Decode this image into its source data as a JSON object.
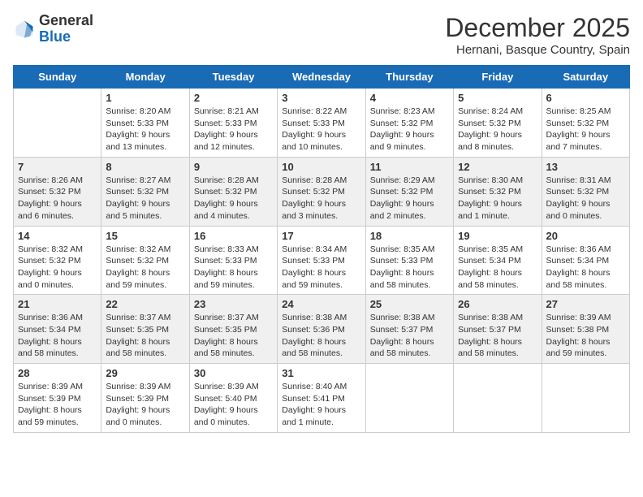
{
  "header": {
    "logo_general": "General",
    "logo_blue": "Blue",
    "month_title": "December 2025",
    "subtitle": "Hernani, Basque Country, Spain"
  },
  "days_of_week": [
    "Sunday",
    "Monday",
    "Tuesday",
    "Wednesday",
    "Thursday",
    "Friday",
    "Saturday"
  ],
  "weeks": [
    [
      {
        "day": "",
        "info": ""
      },
      {
        "day": "1",
        "info": "Sunrise: 8:20 AM\nSunset: 5:33 PM\nDaylight: 9 hours\nand 13 minutes."
      },
      {
        "day": "2",
        "info": "Sunrise: 8:21 AM\nSunset: 5:33 PM\nDaylight: 9 hours\nand 12 minutes."
      },
      {
        "day": "3",
        "info": "Sunrise: 8:22 AM\nSunset: 5:33 PM\nDaylight: 9 hours\nand 10 minutes."
      },
      {
        "day": "4",
        "info": "Sunrise: 8:23 AM\nSunset: 5:32 PM\nDaylight: 9 hours\nand 9 minutes."
      },
      {
        "day": "5",
        "info": "Sunrise: 8:24 AM\nSunset: 5:32 PM\nDaylight: 9 hours\nand 8 minutes."
      },
      {
        "day": "6",
        "info": "Sunrise: 8:25 AM\nSunset: 5:32 PM\nDaylight: 9 hours\nand 7 minutes."
      }
    ],
    [
      {
        "day": "7",
        "info": "Sunrise: 8:26 AM\nSunset: 5:32 PM\nDaylight: 9 hours\nand 6 minutes."
      },
      {
        "day": "8",
        "info": "Sunrise: 8:27 AM\nSunset: 5:32 PM\nDaylight: 9 hours\nand 5 minutes."
      },
      {
        "day": "9",
        "info": "Sunrise: 8:28 AM\nSunset: 5:32 PM\nDaylight: 9 hours\nand 4 minutes."
      },
      {
        "day": "10",
        "info": "Sunrise: 8:28 AM\nSunset: 5:32 PM\nDaylight: 9 hours\nand 3 minutes."
      },
      {
        "day": "11",
        "info": "Sunrise: 8:29 AM\nSunset: 5:32 PM\nDaylight: 9 hours\nand 2 minutes."
      },
      {
        "day": "12",
        "info": "Sunrise: 8:30 AM\nSunset: 5:32 PM\nDaylight: 9 hours\nand 1 minute."
      },
      {
        "day": "13",
        "info": "Sunrise: 8:31 AM\nSunset: 5:32 PM\nDaylight: 9 hours\nand 0 minutes."
      }
    ],
    [
      {
        "day": "14",
        "info": "Sunrise: 8:32 AM\nSunset: 5:32 PM\nDaylight: 9 hours\nand 0 minutes."
      },
      {
        "day": "15",
        "info": "Sunrise: 8:32 AM\nSunset: 5:32 PM\nDaylight: 8 hours\nand 59 minutes."
      },
      {
        "day": "16",
        "info": "Sunrise: 8:33 AM\nSunset: 5:33 PM\nDaylight: 8 hours\nand 59 minutes."
      },
      {
        "day": "17",
        "info": "Sunrise: 8:34 AM\nSunset: 5:33 PM\nDaylight: 8 hours\nand 59 minutes."
      },
      {
        "day": "18",
        "info": "Sunrise: 8:35 AM\nSunset: 5:33 PM\nDaylight: 8 hours\nand 58 minutes."
      },
      {
        "day": "19",
        "info": "Sunrise: 8:35 AM\nSunset: 5:34 PM\nDaylight: 8 hours\nand 58 minutes."
      },
      {
        "day": "20",
        "info": "Sunrise: 8:36 AM\nSunset: 5:34 PM\nDaylight: 8 hours\nand 58 minutes."
      }
    ],
    [
      {
        "day": "21",
        "info": "Sunrise: 8:36 AM\nSunset: 5:34 PM\nDaylight: 8 hours\nand 58 minutes."
      },
      {
        "day": "22",
        "info": "Sunrise: 8:37 AM\nSunset: 5:35 PM\nDaylight: 8 hours\nand 58 minutes."
      },
      {
        "day": "23",
        "info": "Sunrise: 8:37 AM\nSunset: 5:35 PM\nDaylight: 8 hours\nand 58 minutes."
      },
      {
        "day": "24",
        "info": "Sunrise: 8:38 AM\nSunset: 5:36 PM\nDaylight: 8 hours\nand 58 minutes."
      },
      {
        "day": "25",
        "info": "Sunrise: 8:38 AM\nSunset: 5:37 PM\nDaylight: 8 hours\nand 58 minutes."
      },
      {
        "day": "26",
        "info": "Sunrise: 8:38 AM\nSunset: 5:37 PM\nDaylight: 8 hours\nand 58 minutes."
      },
      {
        "day": "27",
        "info": "Sunrise: 8:39 AM\nSunset: 5:38 PM\nDaylight: 8 hours\nand 59 minutes."
      }
    ],
    [
      {
        "day": "28",
        "info": "Sunrise: 8:39 AM\nSunset: 5:39 PM\nDaylight: 8 hours\nand 59 minutes."
      },
      {
        "day": "29",
        "info": "Sunrise: 8:39 AM\nSunset: 5:39 PM\nDaylight: 9 hours\nand 0 minutes."
      },
      {
        "day": "30",
        "info": "Sunrise: 8:39 AM\nSunset: 5:40 PM\nDaylight: 9 hours\nand 0 minutes."
      },
      {
        "day": "31",
        "info": "Sunrise: 8:40 AM\nSunset: 5:41 PM\nDaylight: 9 hours\nand 1 minute."
      },
      {
        "day": "",
        "info": ""
      },
      {
        "day": "",
        "info": ""
      },
      {
        "day": "",
        "info": ""
      }
    ]
  ]
}
